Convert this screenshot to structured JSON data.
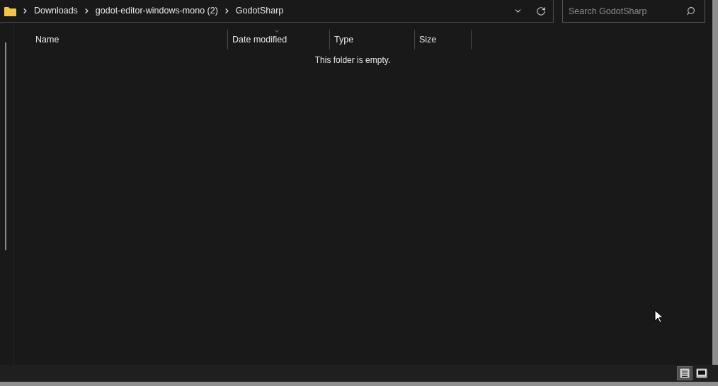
{
  "address_bar": {
    "breadcrumbs": [
      "Downloads",
      "godot-editor-windows-mono (2)",
      "GodotSharp"
    ]
  },
  "search": {
    "placeholder": "Search GodotSharp"
  },
  "columns": [
    {
      "label": "Name",
      "sorted": false
    },
    {
      "label": "Date modified",
      "sorted": true
    },
    {
      "label": "Type",
      "sorted": false
    },
    {
      "label": "Size",
      "sorted": false
    }
  ],
  "empty_message": "This folder is empty.",
  "view_buttons": [
    {
      "kind": "details",
      "selected": true
    },
    {
      "kind": "tiles",
      "selected": false
    }
  ]
}
